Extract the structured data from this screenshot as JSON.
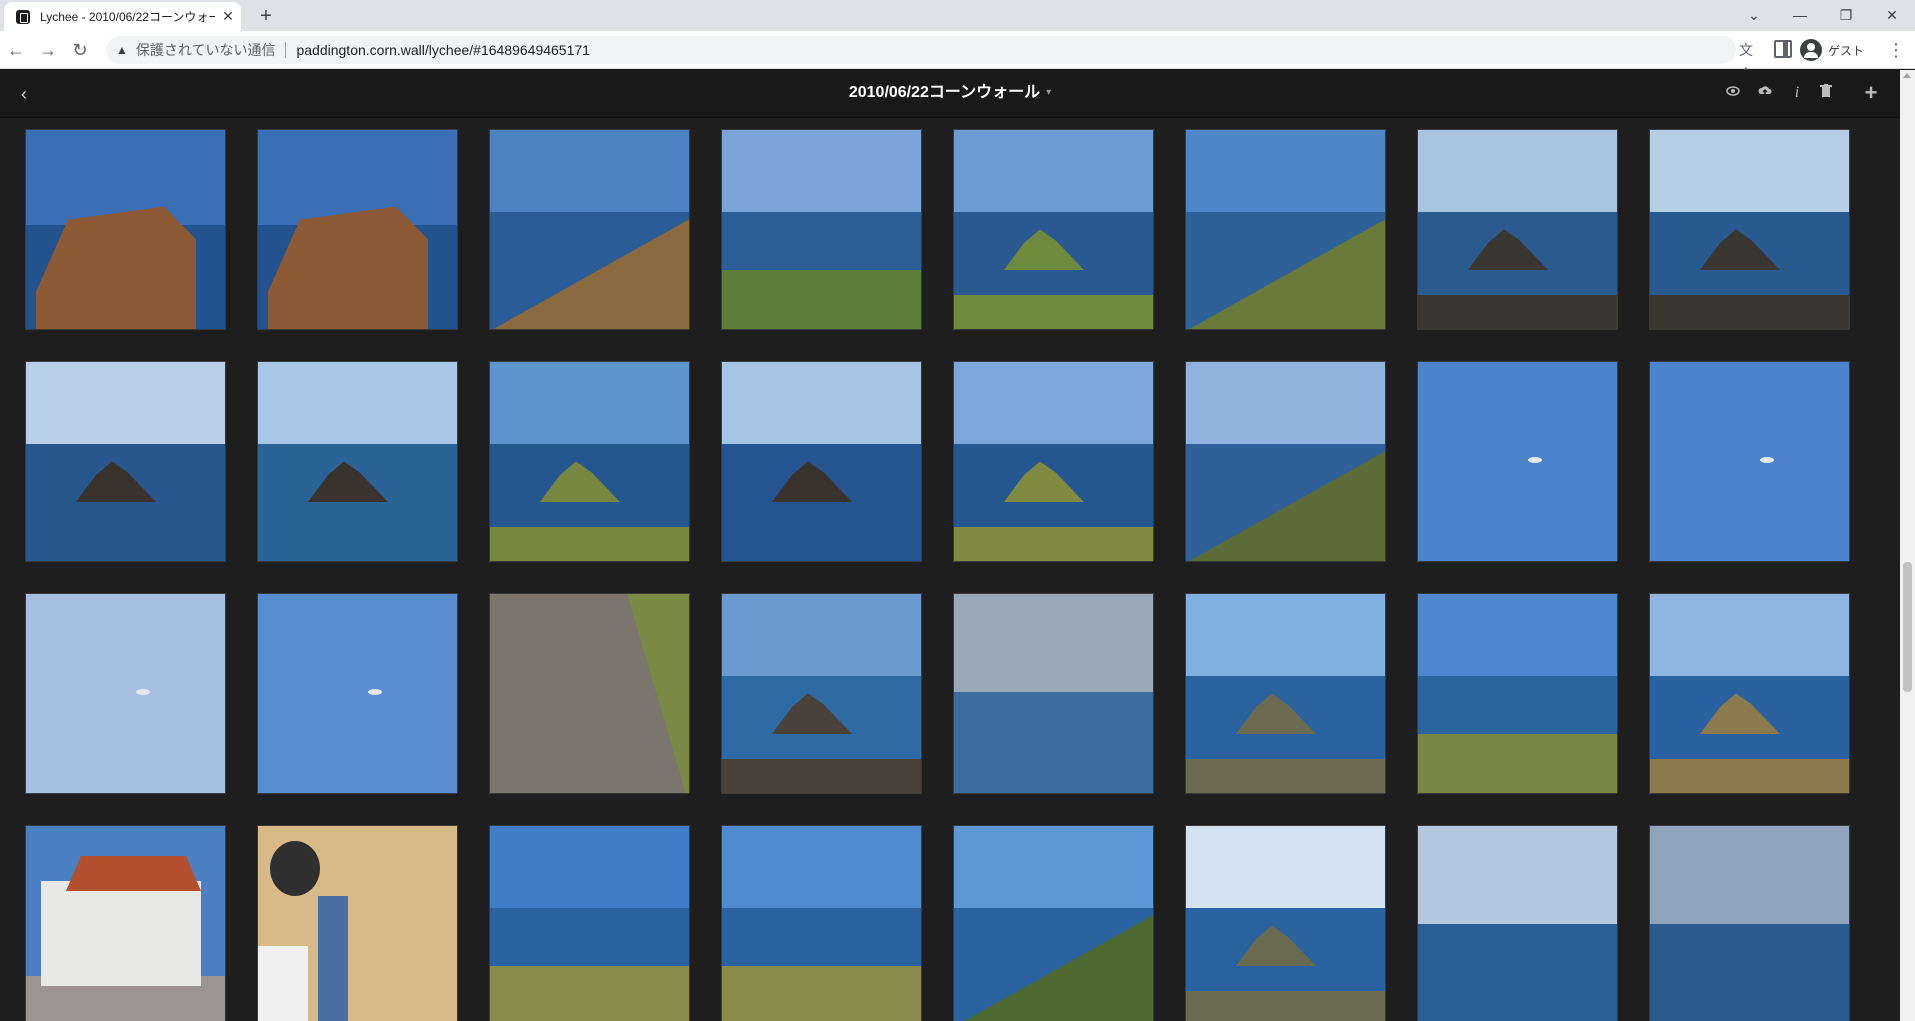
{
  "browser": {
    "tab_title": "Lychee - 2010/06/22コーンウォール",
    "tab_close": "✕",
    "new_tab": "+",
    "security_label": "保護されていない通信",
    "url": "paddington.corn.wall/lychee/#16489649465171",
    "profile_name": "ゲスト",
    "window_controls": {
      "dropdown": "⌄",
      "minimize": "—",
      "restore": "❐",
      "close": "✕"
    },
    "nav": {
      "back": "←",
      "forward": "→",
      "reload": "↻"
    },
    "menu": "⋮"
  },
  "header": {
    "album_title": "2010/06/22コーンウォール",
    "caret": "▾",
    "back": "‹",
    "actions": {
      "visibility": "👁",
      "share": "⇪",
      "info": "i",
      "trash": "🗑",
      "add": "+"
    }
  },
  "colors": {
    "page_bg": "#1e1e1e",
    "header_bg": "#191919",
    "title_color": "#ffffff"
  },
  "photos": [
    {
      "sky": "#3a6fb5",
      "sea": "#22538f",
      "land": "#8c5a34",
      "kind": "cliff"
    },
    {
      "sky": "#3a6fb5",
      "sea": "#22538f",
      "land": "#8c5a34",
      "kind": "cliff"
    },
    {
      "sky": "#4d82c2",
      "sea": "#2a5c97",
      "land": "#8a6a3e",
      "kind": "slope"
    },
    {
      "sky": "#7aa4d8",
      "sea": "#2b5d96",
      "land": "#5f7d3a",
      "kind": "grass"
    },
    {
      "sky": "#6c9bd3",
      "sea": "#2a5991",
      "land": "#6e8a3c",
      "kind": "rock"
    },
    {
      "sky": "#4f86c8",
      "sea": "#2f6199",
      "land": "#6a7a3a",
      "kind": "hill"
    },
    {
      "sky": "#a9c3e0",
      "sea": "#2b5a8e",
      "land": "#3a3630",
      "kind": "rock"
    },
    {
      "sky": "#b6cde6",
      "sea": "#285a90",
      "land": "#3a3630",
      "kind": "rock"
    },
    {
      "sky": "#b8cfe7",
      "sea": "#27578d",
      "land": "#3a332c",
      "kind": "rock"
    },
    {
      "sky": "#a9c6e6",
      "sea": "#2a6396",
      "land": "#3a332c",
      "kind": "rock"
    },
    {
      "sky": "#5f93cf",
      "sea": "#24578f",
      "land": "#78873f",
      "kind": "rock"
    },
    {
      "sky": "#a6c4e3",
      "sea": "#245590",
      "land": "#3a332c",
      "kind": "rock"
    },
    {
      "sky": "#7ca7da",
      "sea": "#24578f",
      "land": "#808a40",
      "kind": "rock"
    },
    {
      "sky": "#8fb3dc",
      "sea": "#30609a",
      "land": "#5c6c36",
      "kind": "hill"
    },
    {
      "sky": "#4c84cc",
      "sea": "#4c84cc",
      "land": "#4c84cc",
      "kind": "sky"
    },
    {
      "sky": "#4c84cc",
      "sea": "#4c84cc",
      "land": "#4c84cc",
      "kind": "sky"
    },
    {
      "sky": "#a6bfe0",
      "sea": "#a6bfe0",
      "land": "#a6bfe0",
      "kind": "sky"
    },
    {
      "sky": "#5a8dd0",
      "sea": "#5a8dd0",
      "land": "#5a8dd0",
      "kind": "sky"
    },
    {
      "sky": "#7b766d",
      "sea": "#7b766d",
      "land": "#7a8a45",
      "kind": "path"
    },
    {
      "sky": "#6a9ad0",
      "sea": "#2e6aa4",
      "land": "#4a4238",
      "kind": "rock"
    },
    {
      "sky": "#9aa9b9",
      "sea": "#3c6d9e",
      "land": "#3c6d9e",
      "kind": "sea"
    },
    {
      "sky": "#7fb0e0",
      "sea": "#2a63a0",
      "land": "#6d6a52",
      "kind": "rock"
    },
    {
      "sky": "#4d87cd",
      "sea": "#2c64a0",
      "land": "#7a8645",
      "kind": "grass"
    },
    {
      "sky": "#8fb5e0",
      "sea": "#2a61a0",
      "land": "#8a7a4c",
      "kind": "rock"
    },
    {
      "sky": "#4a7fc2",
      "sea": "#9a9492",
      "land": "#e8e8e6",
      "kind": "house"
    },
    {
      "sky": "#d8b988",
      "sea": "#d8b988",
      "land": "#4a6fa3",
      "kind": "busker"
    },
    {
      "sky": "#3f7dc8",
      "sea": "#2a63a0",
      "land": "#8a8a4a",
      "kind": "grass"
    },
    {
      "sky": "#4f8ccf",
      "sea": "#2a63a0",
      "land": "#8a8a4a",
      "kind": "grass"
    },
    {
      "sky": "#5c97d6",
      "sea": "#2a63a0",
      "land": "#4f6a30",
      "kind": "hill"
    },
    {
      "sky": "#d4e3f2",
      "sea": "#2a63a0",
      "land": "#6a6a50",
      "kind": "rock"
    },
    {
      "sky": "#b4c8df",
      "sea": "#2a5f95",
      "land": "#2a5f95",
      "kind": "sea"
    },
    {
      "sky": "#8fa3bd",
      "sea": "#2b5b8d",
      "land": "#2b5b8d",
      "kind": "sea"
    }
  ]
}
